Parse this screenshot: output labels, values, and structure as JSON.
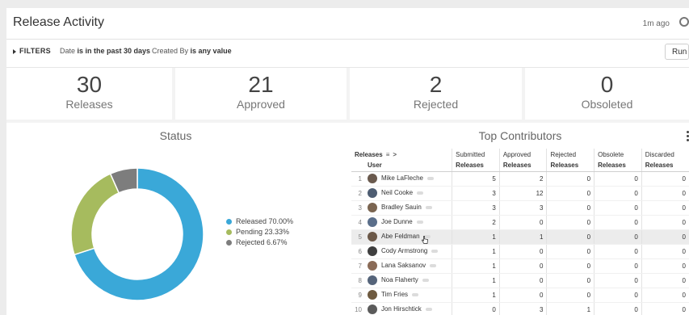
{
  "header": {
    "title": "Release Activity",
    "updated": "1m ago"
  },
  "filters": {
    "label": "FILTERS",
    "f1_prefix": "Date",
    "f1_value": "is in the past 30 days",
    "f2_prefix": "Created By",
    "f2_value": "is any value",
    "run_label": "Run"
  },
  "kpis": [
    {
      "value": "30",
      "label": "Releases"
    },
    {
      "value": "21",
      "label": "Approved"
    },
    {
      "value": "2",
      "label": "Rejected"
    },
    {
      "value": "0",
      "label": "Obsoleted"
    }
  ],
  "status": {
    "title": "Status",
    "legend": [
      {
        "label": "Released 70.00%",
        "color": "#3aa8d8"
      },
      {
        "label": "Pending 23.33%",
        "color": "#a6bb5e"
      },
      {
        "label": "Rejected 6.67%",
        "color": "#7d7d7d"
      }
    ]
  },
  "chart_data": {
    "type": "pie",
    "donut": true,
    "title": "Status",
    "categories": [
      "Released",
      "Pending",
      "Rejected"
    ],
    "values": [
      70.0,
      23.33,
      6.67
    ],
    "colors": [
      "#3aa8d8",
      "#a6bb5e",
      "#7d7d7d"
    ],
    "legend_position": "right"
  },
  "contributors": {
    "title": "Top Contributors",
    "pivot_label": "Releases",
    "pivot_chevron": ">",
    "group_headers": [
      "Submitted",
      "Approved",
      "Rejected",
      "Obsolete",
      "Discarded"
    ],
    "user_header": "User",
    "sub_header": "Releases",
    "rows": [
      {
        "idx": "1",
        "name": "Mike LaFleche",
        "v": [
          "5",
          "2",
          "0",
          "0",
          "0"
        ]
      },
      {
        "idx": "2",
        "name": "Neil Cooke",
        "v": [
          "3",
          "12",
          "0",
          "0",
          "0"
        ]
      },
      {
        "idx": "3",
        "name": "Bradley Sauin",
        "v": [
          "3",
          "3",
          "0",
          "0",
          "0"
        ]
      },
      {
        "idx": "4",
        "name": "Joe Dunne",
        "v": [
          "2",
          "0",
          "0",
          "0",
          "0"
        ]
      },
      {
        "idx": "5",
        "name": "Abe Feldman",
        "v": [
          "1",
          "1",
          "0",
          "0",
          "0"
        ]
      },
      {
        "idx": "6",
        "name": "Cody Armstrong",
        "v": [
          "1",
          "0",
          "0",
          "0",
          "0"
        ]
      },
      {
        "idx": "7",
        "name": "Lana Saksanov",
        "v": [
          "1",
          "0",
          "0",
          "0",
          "0"
        ]
      },
      {
        "idx": "8",
        "name": "Noa Flaherty",
        "v": [
          "1",
          "0",
          "0",
          "0",
          "0"
        ]
      },
      {
        "idx": "9",
        "name": "Tim Fries",
        "v": [
          "1",
          "0",
          "0",
          "0",
          "0"
        ]
      },
      {
        "idx": "10",
        "name": "Jon Hirschtick",
        "v": [
          "0",
          "3",
          "1",
          "0",
          "0"
        ]
      }
    ],
    "highlighted_row": 4
  },
  "icons": {
    "settings": "gear-icon",
    "filters_toggle": "caret-right-icon",
    "more": "kebab-menu-icon",
    "pivot": "pivot-icon",
    "row_actions": "ellipsis-icon",
    "cursor": "hand-pointer-icon"
  }
}
